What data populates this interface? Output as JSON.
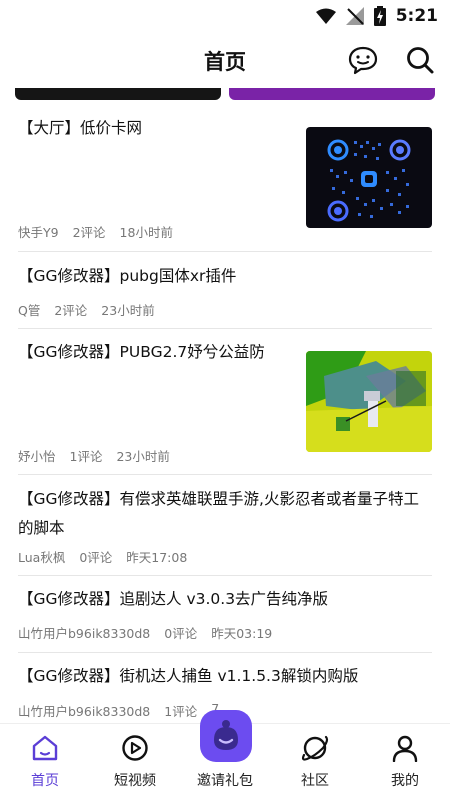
{
  "status_bar": {
    "time": "5:21"
  },
  "header": {
    "title": "首页"
  },
  "posts": [
    {
      "title": "【大厅】低价卡网",
      "author": "快手Y9",
      "comments": "2评论",
      "time": "18小时前"
    },
    {
      "title": "【GG修改器】pubg国体xr插件",
      "author": "Q管",
      "comments": "2评论",
      "time": "23小时前"
    },
    {
      "title": "【GG修改器】PUBG2.7妤兮公益防",
      "author": "妤小怡",
      "comments": "1评论",
      "time": "23小时前"
    },
    {
      "title": "【GG修改器】有偿求英雄联盟手游,火影忍者或者量子特工的脚本",
      "author": "Lua秋枫",
      "comments": "0评论",
      "time": "昨天17:08"
    },
    {
      "title": "【GG修改器】追剧达人 v3.0.3去广告纯净版",
      "author": "山竹用户b96ik8330d8",
      "comments": "0评论",
      "time": "昨天03:19"
    },
    {
      "title": "【GG修改器】街机达人捕鱼 v1.1.5.3解锁内购版",
      "author": "山竹用户b96ik8330d8",
      "comments": "1评论",
      "time": "7"
    }
  ],
  "nav": {
    "home": "首页",
    "short_video": "短视频",
    "invite": "邀请礼包",
    "community": "社区",
    "mine": "我的"
  },
  "colors": {
    "accent": "#5b3ed6",
    "invite_bg": "#6c4cf0",
    "banner_purple": "#7a23a7"
  }
}
